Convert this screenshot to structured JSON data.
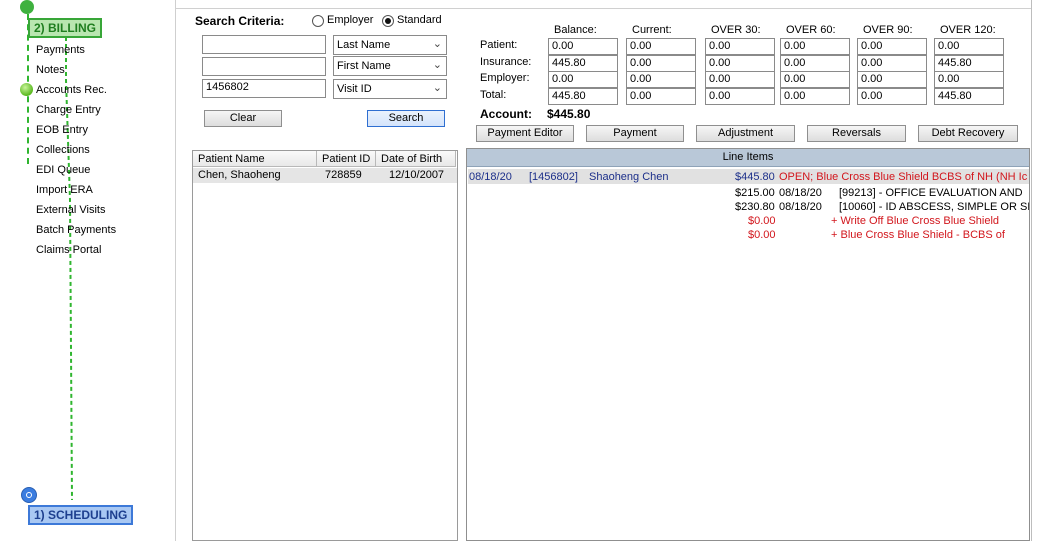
{
  "nav": {
    "billing_badge": "2) BILLING",
    "scheduling_badge": "1) SCHEDULING",
    "items": [
      "Payments",
      "Notes",
      "Accounts Rec.",
      "Charge Entry",
      "EOB Entry",
      "Collections",
      "EDI Queue",
      "Import ERA",
      "External Visits",
      "Batch Payments",
      "Claims Portal"
    ]
  },
  "search": {
    "label": "Search Criteria:",
    "radio_employer": "Employer",
    "radio_standard": "Standard",
    "selected_mode": "Standard",
    "input1": "",
    "input2": "",
    "input3": "1456802",
    "select1": "Last Name",
    "select2": "First Name",
    "select3": "Visit ID",
    "clear": "Clear",
    "search": "Search"
  },
  "balances": {
    "columns": [
      "Balance:",
      "Current:",
      "OVER 30:",
      "OVER 60:",
      "OVER 90:",
      "OVER 120:"
    ],
    "rows": [
      {
        "label": "Patient:",
        "values": [
          "0.00",
          "0.00",
          "0.00",
          "0.00",
          "0.00",
          "0.00"
        ]
      },
      {
        "label": "Insurance:",
        "values": [
          "445.80",
          "0.00",
          "0.00",
          "0.00",
          "0.00",
          "445.80"
        ]
      },
      {
        "label": "Employer:",
        "values": [
          "0.00",
          "0.00",
          "0.00",
          "0.00",
          "0.00",
          "0.00"
        ]
      },
      {
        "label": "Total:",
        "values": [
          "445.80",
          "0.00",
          "0.00",
          "0.00",
          "0.00",
          "445.80"
        ]
      }
    ],
    "account_label": "Account:",
    "account_value": "$445.80"
  },
  "actions": [
    "Payment Editor",
    "Payment",
    "Adjustment",
    "Reversals",
    "Debt Recovery"
  ],
  "patients": {
    "headers": [
      "Patient Name",
      "Patient ID",
      "Date of Birth"
    ],
    "rows": [
      {
        "name": "Chen, Shaoheng",
        "id": "728859",
        "dob": "12/10/2007"
      }
    ]
  },
  "line_items": {
    "title": "Line Items",
    "header_row": {
      "date": "08/18/20",
      "visit": "[1456802]",
      "patient": "Shaoheng Chen",
      "amount": "$445.80",
      "status": "OPEN;  Blue Cross Blue Shield BCBS of NH (NH Ic"
    },
    "charges": [
      {
        "amount": "$215.00",
        "date": "08/18/20",
        "desc": "[99213] - OFFICE EVALUATION AND"
      },
      {
        "amount": "$230.80",
        "date": "08/18/20",
        "desc": "[10060] - ID ABSCESS, SIMPLE OR SII"
      }
    ],
    "adjustments": [
      {
        "amount": "$0.00",
        "desc": "+ Write Off  Blue Cross Blue Shield"
      },
      {
        "amount": "$0.00",
        "desc": "+ Blue Cross Blue Shield - BCBS of"
      }
    ]
  },
  "colors": {
    "billing_green": "#38a638",
    "scheduling_blue": "#3d79d8",
    "list_header": "#b9c8d8",
    "red_text": "#d2161c",
    "blue_text": "#1c2f8a"
  }
}
